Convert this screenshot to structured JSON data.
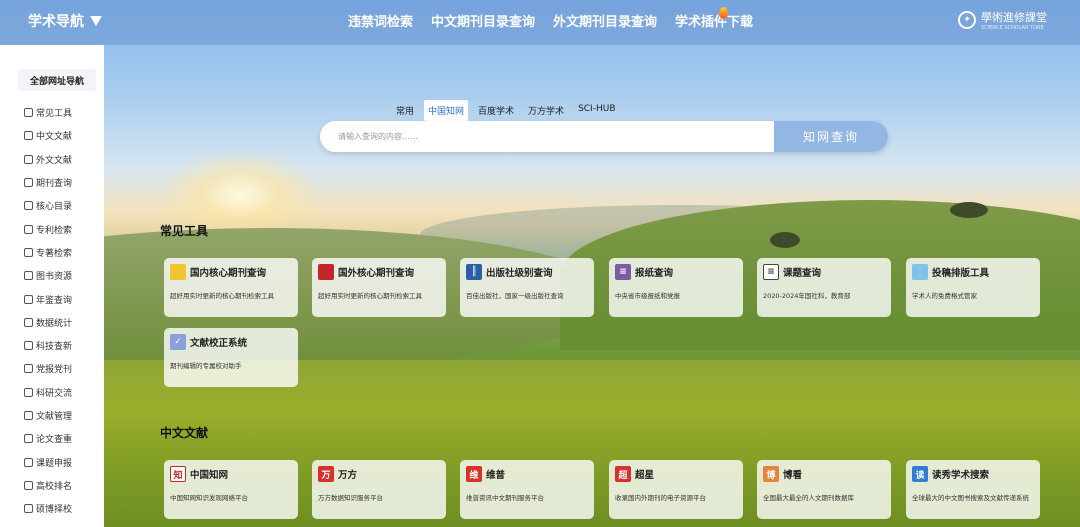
{
  "topbar": {
    "brand": "学术导航",
    "nav": [
      "违禁词检索",
      "中文期刊目录查询",
      "外文期刊目录查询",
      "学术插件下载"
    ],
    "logo_text": "學術進修課堂",
    "logo_sub": "SCIENCE SCHOLAR TORE"
  },
  "sidebar": {
    "header": "全部网址导航",
    "items": [
      "常见工具",
      "中文文献",
      "外文文献",
      "期刊查询",
      "核心目录",
      "专利检索",
      "专著检索",
      "图书资源",
      "年鉴查询",
      "数据统计",
      "科技查新",
      "党报党刊",
      "科研交流",
      "文献管理",
      "论文查重",
      "课题申报",
      "高校排名",
      "硕博择校"
    ]
  },
  "search": {
    "tabs": [
      "常用",
      "中国知网",
      "百度学术",
      "万方学术",
      "SCI-HUB"
    ],
    "active_tab": "中国知网",
    "placeholder": "请输入查询的内容……",
    "button": "知网查询"
  },
  "sections": {
    "tools_title": "常见工具",
    "tools": [
      {
        "name": "国内核心期刊查询",
        "desc": "超好用实时更新的核心期刊检索工具",
        "icon": "folder-icon",
        "color": "#f2c430"
      },
      {
        "name": "国外核心期刊查询",
        "desc": "超好用实时更新的核心期刊检索工具",
        "icon": "book-icon",
        "color": "#c3262c"
      },
      {
        "name": "出版社级别查询",
        "desc": "百佳出版社，国家一级出版社查询",
        "icon": "bars-icon",
        "color": "#2d5fa8"
      },
      {
        "name": "报纸查询",
        "desc": "中央省市级报纸和党报",
        "icon": "newspaper-icon",
        "color": "#7b5aa6"
      },
      {
        "name": "课题查询",
        "desc": "2020-2024年国社科，教育部",
        "icon": "list-icon",
        "color": "#444444"
      },
      {
        "name": "投稿排版工具",
        "desc": "学术人的免费格式管家",
        "icon": "image-icon",
        "color": "#7fc4e8"
      },
      {
        "name": "文献校正系统",
        "desc": "期刊编辑的专属校对助手",
        "icon": "document-check-icon",
        "color": "#8aa0d8"
      }
    ],
    "cn_title": "中文文献",
    "cn": [
      {
        "name": "中国知网",
        "desc": "中国知网知识发现网络平台",
        "icon": "cnki-icon",
        "color": "#c3262c"
      },
      {
        "name": "万方",
        "desc": "万方数据知识服务平台",
        "icon": "wanfang-icon",
        "color": "#d8302a"
      },
      {
        "name": "维普",
        "desc": "维普资讯中文期刊服务平台",
        "icon": "weipu-icon",
        "color": "#d8302a"
      },
      {
        "name": "超星",
        "desc": "收录国内外期刊的电子资源平台",
        "icon": "chaoxing-icon",
        "color": "#d8302a"
      },
      {
        "name": "博看",
        "desc": "全国最大最全的人文期刊数据库",
        "icon": "bookan-icon",
        "color": "#e8823a"
      },
      {
        "name": "读秀学术搜索",
        "desc": "全球最大的中文图书搜索及文献传递系统",
        "icon": "duxiu-icon",
        "color": "#2d7ed6"
      }
    ]
  }
}
